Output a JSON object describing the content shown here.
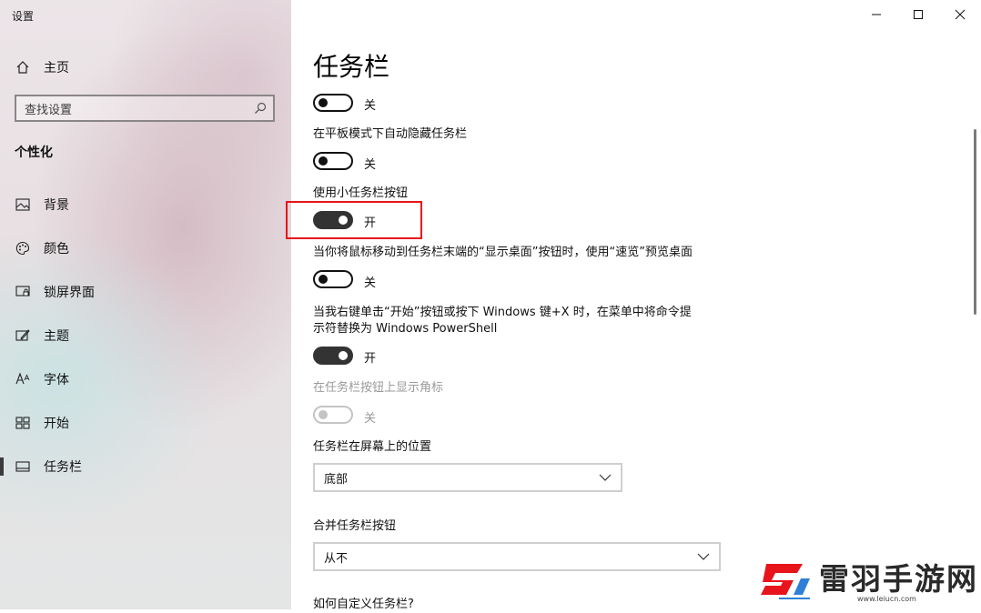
{
  "window": {
    "title": "设置",
    "controls": [
      "minimize",
      "maximize",
      "close"
    ]
  },
  "sidebar": {
    "home_label": "主页",
    "search_placeholder": "查找设置",
    "section_title": "个性化",
    "items": [
      {
        "label": "背景",
        "icon": "picture-icon",
        "selected": false
      },
      {
        "label": "颜色",
        "icon": "palette-icon",
        "selected": false
      },
      {
        "label": "锁屏界面",
        "icon": "lock-screen-icon",
        "selected": false
      },
      {
        "label": "主题",
        "icon": "theme-icon",
        "selected": false
      },
      {
        "label": "字体",
        "icon": "font-icon",
        "selected": false
      },
      {
        "label": "开始",
        "icon": "start-icon",
        "selected": false
      },
      {
        "label": "任务栏",
        "icon": "taskbar-icon",
        "selected": true
      }
    ]
  },
  "main": {
    "page_title": "任务栏",
    "settings": [
      {
        "label": "",
        "state_text": "关",
        "on": false,
        "disabled": false
      },
      {
        "label": "在平板模式下自动隐藏任务栏",
        "state_text": "关",
        "on": false,
        "disabled": false
      },
      {
        "label": "使用小任务栏按钮",
        "state_text": "开",
        "on": true,
        "disabled": false,
        "highlighted": true
      },
      {
        "label": "当你将鼠标移动到任务栏末端的“显示桌面”按钮时，使用“速览”预览桌面",
        "state_text": "关",
        "on": false,
        "disabled": false
      },
      {
        "label_line1": "当我右键单击“开始”按钮或按下 Windows 键+X 时，在菜单中将命令提",
        "label_line2": "示符替换为 Windows PowerShell",
        "state_text": "开",
        "on": true,
        "disabled": false
      },
      {
        "label": "在任务栏按钮上显示角标",
        "state_text": "关",
        "on": false,
        "disabled": true
      }
    ],
    "position": {
      "label": "任务栏在屏幕上的位置",
      "value": "底部"
    },
    "combine": {
      "label": "合并任务栏按钮",
      "value": "从不"
    },
    "customize_link": "如何自定义任务栏?"
  },
  "watermark": {
    "text": "雷羽手游网",
    "url": "www.leiucn.com"
  },
  "colors": {
    "highlight_box": "#e8141b",
    "toggle_on": "#333333",
    "sidebar_bg": "#e9e2e5"
  }
}
